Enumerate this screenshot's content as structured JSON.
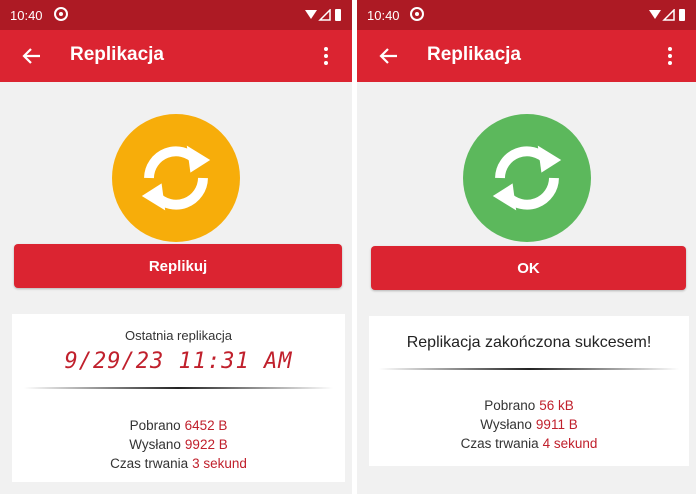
{
  "left": {
    "status": {
      "time": "10:40"
    },
    "appbar": {
      "title": "Replikacja"
    },
    "sync_icon": {
      "icon": "sync-icon",
      "color": "#f7ad0a"
    },
    "button": {
      "label": "Replikuj"
    },
    "card": {
      "heading": "Ostatnia replikacja",
      "timestamp": "9/29/23 11:31 AM",
      "stats": [
        {
          "label": "Pobrano",
          "value": "6452 B"
        },
        {
          "label": "Wysłano",
          "value": "9922 B"
        },
        {
          "label": "Czas trwania",
          "value": "3 sekund"
        }
      ]
    }
  },
  "right": {
    "status": {
      "time": "10:40"
    },
    "appbar": {
      "title": "Replikacja"
    },
    "sync_icon": {
      "icon": "sync-icon",
      "color": "#5cb85c"
    },
    "button": {
      "label": "OK"
    },
    "card": {
      "message": "Replikacja zakończona sukcesem!",
      "stats": [
        {
          "label": "Pobrano",
          "value": "56 kB"
        },
        {
          "label": "Wysłano",
          "value": "9911 B"
        },
        {
          "label": "Czas trwania",
          "value": "4 sekund"
        }
      ]
    }
  },
  "colors": {
    "statusbar": "#ad1a24",
    "appbar": "#db2431",
    "value_text": "#c0202c"
  }
}
